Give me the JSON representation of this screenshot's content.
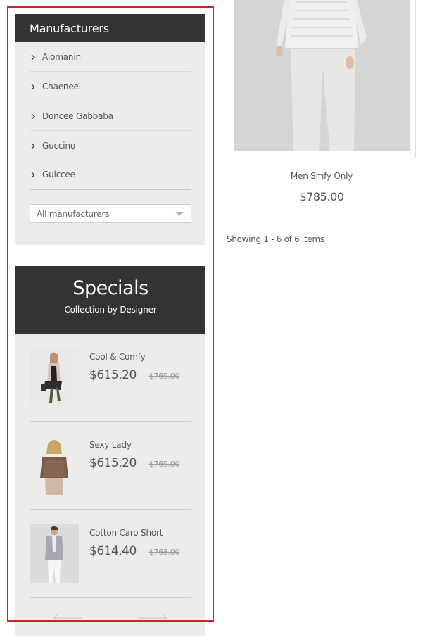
{
  "manufacturers": {
    "title": "Manufacturers",
    "items": [
      {
        "label": "Aiomanin"
      },
      {
        "label": "Chaeneel"
      },
      {
        "label": "Doncee Gabbaba"
      },
      {
        "label": "Guccino"
      },
      {
        "label": "Guiccee"
      }
    ],
    "select": {
      "value": "All manufacturers"
    }
  },
  "specials": {
    "title": "Specials",
    "subtitle": "Collection by Designer",
    "items": [
      {
        "name": "Cool & Comfy",
        "price": "$615.20",
        "old_price": "$769.00"
      },
      {
        "name": "Sexy Lady",
        "price": "$615.20",
        "old_price": "$769.00"
      },
      {
        "name": "Cotton Caro Short",
        "price": "$614.40",
        "old_price": "$768.00"
      }
    ]
  },
  "product": {
    "name": "Men Smfy Only",
    "price": "$785.00"
  },
  "pagination": {
    "showing": "Showing 1 - 6 of 6 items"
  },
  "colors": {
    "header_bg": "#333333",
    "block_bg": "#ececec",
    "highlight": "#d0202a"
  }
}
